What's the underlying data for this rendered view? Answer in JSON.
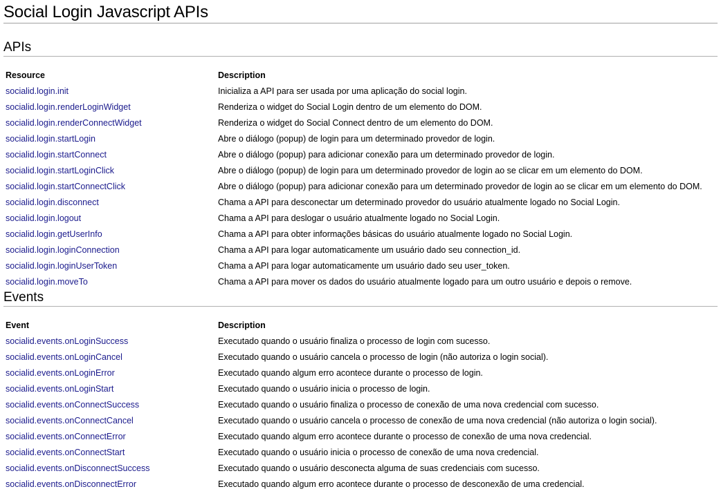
{
  "title": "Social Login Javascript APIs",
  "apis": {
    "heading": "APIs",
    "headers": {
      "resource": "Resource",
      "description": "Description"
    },
    "rows": [
      {
        "name": "socialid.login.init",
        "desc": "Inicializa a API para ser usada por uma aplicação do social login."
      },
      {
        "name": "socialid.login.renderLoginWidget",
        "desc": "Renderiza o widget do Social Login dentro de um elemento do DOM."
      },
      {
        "name": "socialid.login.renderConnectWidget",
        "desc": "Renderiza o widget do Social Connect dentro de um elemento do DOM."
      },
      {
        "name": "socialid.login.startLogin",
        "desc": "Abre o diálogo (popup) de login para um determinado provedor de login."
      },
      {
        "name": "socialid.login.startConnect",
        "desc": "Abre o diálogo (popup) para adicionar conexão para um determinado provedor de login."
      },
      {
        "name": "socialid.login.startLoginClick",
        "desc": "Abre o diálogo (popup) de login para um determinado provedor de login ao se clicar em um elemento do DOM."
      },
      {
        "name": "socialid.login.startConnectClick",
        "desc": "Abre o diálogo (popup) para adicionar conexão para um determinado provedor de login ao se clicar em um elemento do DOM."
      },
      {
        "name": "socialid.login.disconnect",
        "desc": "Chama a API para desconectar um determinado provedor do usuário atualmente logado no Social Login."
      },
      {
        "name": "socialid.login.logout",
        "desc": "Chama a API para deslogar o usuário atualmente logado no Social Login."
      },
      {
        "name": "socialid.login.getUserInfo",
        "desc": "Chama a API para obter informações básicas do usuário atualmente logado no Social Login."
      },
      {
        "name": "socialid.login.loginConnection",
        "desc": "Chama a API para logar automaticamente um usuário dado seu connection_id."
      },
      {
        "name": "socialid.login.loginUserToken",
        "desc": "Chama a API para logar automaticamente um usuário dado seu user_token."
      },
      {
        "name": "socialid.login.moveTo",
        "desc": "Chama a API para mover os dados do usuário atualmente logado para um outro usuário e depois o remove."
      }
    ]
  },
  "events": {
    "heading": "Events",
    "headers": {
      "event": "Event",
      "description": "Description"
    },
    "rows": [
      {
        "name": "socialid.events.onLoginSuccess",
        "desc": "Executado quando o usuário finaliza o processo de login com sucesso."
      },
      {
        "name": "socialid.events.onLoginCancel",
        "desc": "Executado quando o usuário cancela o processo de login (não autoriza o login social)."
      },
      {
        "name": "socialid.events.onLoginError",
        "desc": "Executado quando algum erro acontece durante o processo de login."
      },
      {
        "name": "socialid.events.onLoginStart",
        "desc": "Executado quando o usuário inicia o processo de login."
      },
      {
        "name": "socialid.events.onConnectSuccess",
        "desc": "Executado quando o usuário finaliza o processo de conexão de uma nova credencial com sucesso."
      },
      {
        "name": "socialid.events.onConnectCancel",
        "desc": "Executado quando o usuário cancela o processo de conexão de uma nova credencial (não autoriza o login social)."
      },
      {
        "name": "socialid.events.onConnectError",
        "desc": "Executado quando algum erro acontece durante o processo de conexão de uma nova credencial."
      },
      {
        "name": "socialid.events.onConnectStart",
        "desc": "Executado quando o usuário inicia o processo de conexão de uma nova credencial."
      },
      {
        "name": "socialid.events.onDisconnectSuccess",
        "desc": "Executado quando o usuário desconecta alguma de suas credenciais com sucesso."
      },
      {
        "name": "socialid.events.onDisconnectError",
        "desc": "Executado quando algum erro acontece durante o processo de desconexão de uma credencial."
      }
    ]
  }
}
